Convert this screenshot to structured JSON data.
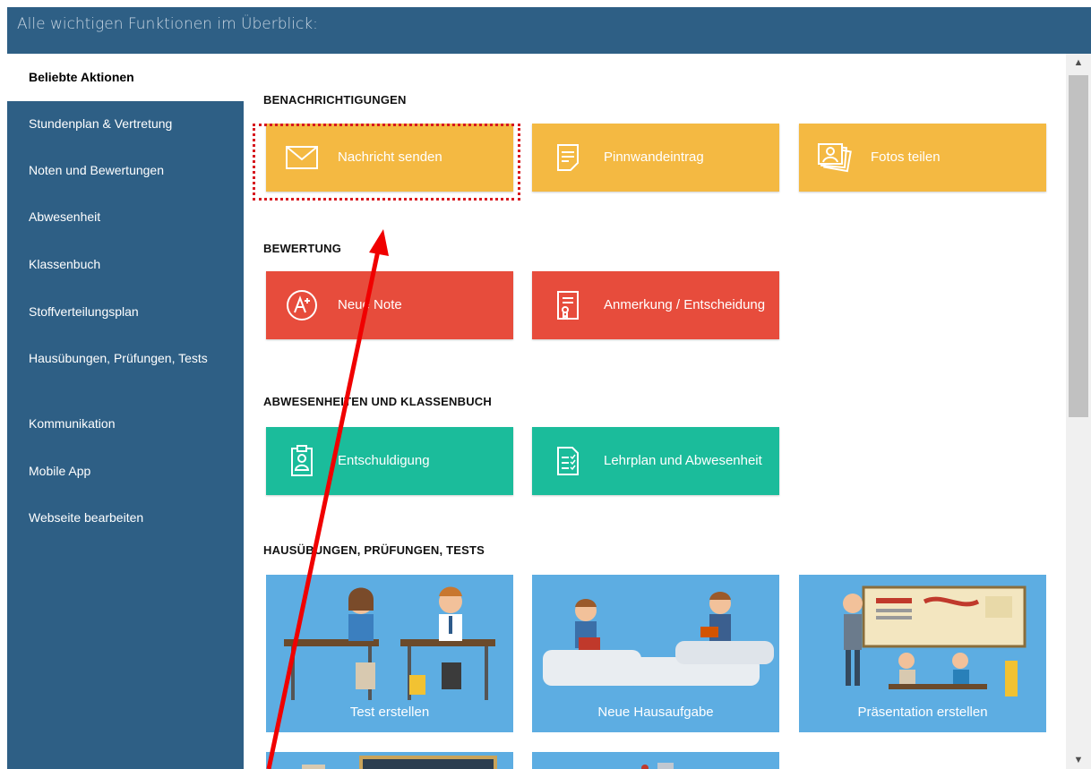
{
  "header": {
    "title": "Alle wichtigen Funktionen im Überblick:"
  },
  "sidebar": {
    "items": [
      {
        "label": "Beliebte Aktionen"
      },
      {
        "label": "Stundenplan & Vertretung"
      },
      {
        "label": "Noten und Bewertungen"
      },
      {
        "label": "Abwesenheit"
      },
      {
        "label": "Klassenbuch"
      },
      {
        "label": "Stoffverteilungsplan"
      },
      {
        "label": "Hausübungen, Prüfungen, Tests"
      },
      {
        "label": "Kommunikation"
      },
      {
        "label": "Mobile App"
      },
      {
        "label": "Webseite bearbeiten"
      }
    ]
  },
  "sections": {
    "notifications": {
      "title": "BENACHRICHTIGUNGEN",
      "tiles": [
        "Nachricht senden",
        "Pinnwandeintrag",
        "Fotos teilen"
      ]
    },
    "grading": {
      "title": "BEWERTUNG",
      "tiles": [
        "Neue Note",
        "Anmerkung / Entscheidung"
      ]
    },
    "absence": {
      "title": "ABWESENHEITEN UND KLASSENBUCH",
      "tiles": [
        "Entschuldigung",
        "Lehrplan und Abwesenheit"
      ]
    },
    "homework": {
      "title": "HAUSÜBUNGEN, PRÜFUNGEN, TESTS",
      "tiles": [
        "Test erstellen",
        "Neue Hausaufgabe",
        "Präsentation erstellen"
      ]
    }
  },
  "colors": {
    "header": "#2e5f85",
    "orange": "#f4b942",
    "red": "#e74c3c",
    "green": "#1bbc9b",
    "blue": "#5dade2",
    "annotation": "#d71920"
  }
}
